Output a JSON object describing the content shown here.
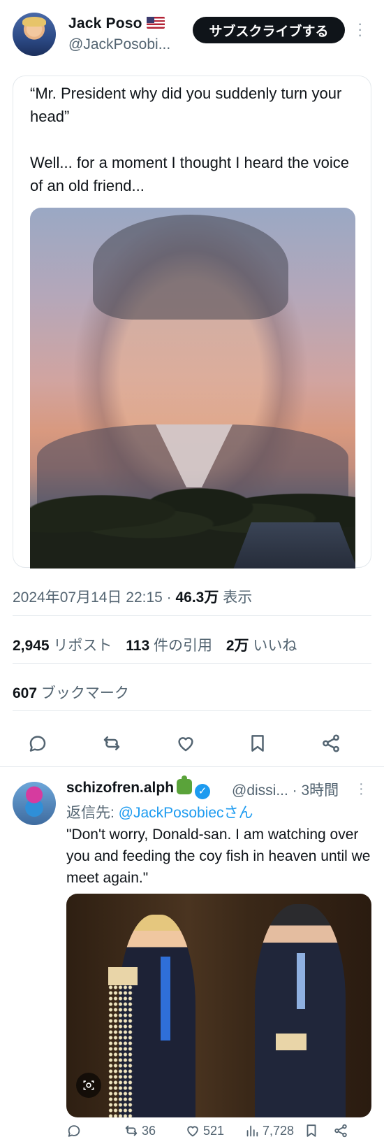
{
  "main_tweet": {
    "author": {
      "name": "Jack Poso",
      "flag": "🇺🇸",
      "handle": "@JackPosobi..."
    },
    "subscribe_label": "サブスクライブする",
    "text_line1": "“Mr. President why did you suddenly turn your head”",
    "text_line2": "Well... for a moment I thought I heard the voice of an old friend...",
    "timestamp": "2024年07月14日 22:15 · ",
    "views_count": "46.3万",
    "views_label": " 表示",
    "stats": {
      "reposts_count": "2,945",
      "reposts_label": " リポスト",
      "quotes_count": "113",
      "quotes_label": " 件の引用",
      "likes_count": "2万",
      "likes_label": " いいね",
      "bookmarks_count": "607",
      "bookmarks_label": " ブックマーク"
    },
    "actions": [
      "reply-icon",
      "repost-icon",
      "like-icon",
      "bookmark-icon",
      "share-icon"
    ]
  },
  "reply": {
    "author_name": "schizofren.alph",
    "handle": "@dissi...",
    "time": " · 3時間",
    "reply_to_prefix": "返信先: ",
    "reply_to_mention": "@JackPosobiecさん",
    "text": "\"Don't worry, Donald-san. I am watching over you and feeding the coy fish in heaven until we meet again.\"",
    "counts": {
      "reposts": "36",
      "likes": "521",
      "views": "7,728"
    }
  },
  "colors": {
    "accent": "#1d9bf0",
    "text": "#0f1419",
    "muted": "#536471",
    "border": "#e3e8ec"
  }
}
